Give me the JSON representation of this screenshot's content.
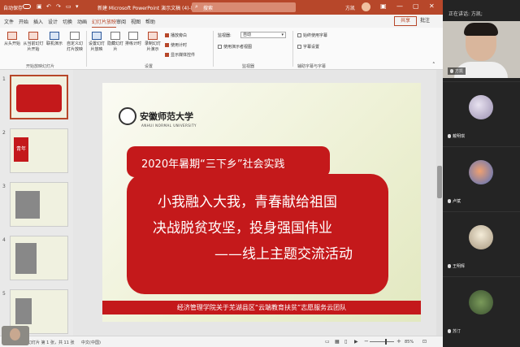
{
  "titlebar": {
    "autosave_label": "自动保存",
    "autosave_state": "关",
    "doc_title": "新建 Microsoft PowerPoint 演示文稿 (4)-已编辑.pptx",
    "search_placeholder": "搜索",
    "user_name": "方凯"
  },
  "menu": {
    "tabs": [
      "文件",
      "开始",
      "插入",
      "设计",
      "切换",
      "动画",
      "幻灯片放映",
      "审阅",
      "视图",
      "帮助"
    ],
    "active_index": 6,
    "share_label": "共享",
    "comment_label": "批注"
  },
  "ribbon": {
    "groups": [
      {
        "label": "开始放映幻灯片",
        "buttons": [
          "从头开始",
          "从当前幻灯片开始",
          "联机演示",
          "自定义幻灯片放映"
        ]
      },
      {
        "label": "设置",
        "buttons": [
          "设置幻灯片放映",
          "隐藏幻灯片",
          "排练计时",
          "录制幻灯片演示"
        ]
      },
      {
        "label": "监视器",
        "buttons": []
      },
      {
        "label": "辅助字幕与字幕",
        "buttons": []
      }
    ],
    "checkboxes": [
      {
        "label": "播放旁白",
        "checked": true
      },
      {
        "label": "使用计时",
        "checked": true
      },
      {
        "label": "显示媒体控件",
        "checked": true
      },
      {
        "label": "始终使用字幕",
        "checked": false
      }
    ],
    "monitor_label": "监视器:",
    "monitor_value": "自动",
    "presenter_view_label": "使用演示者视图",
    "subtitle_settings_label": "字幕设置"
  },
  "slide": {
    "university_name": "安徽师范大学",
    "university_en": "ANHUI NORMAL UNIVERSITY",
    "title": "2020年暑期“三下乡”社会实践",
    "line1": "小我融入大我，青春献给祖国",
    "line2": "决战脱贫攻坚，投身强国伟业",
    "line3": "——线上主题交流活动",
    "footer": "经济管理学院关于芜湖县区“云端教育扶贫”志愿服务云团队"
  },
  "thumbnails": {
    "numbers": [
      "1",
      "2",
      "3",
      "4",
      "5"
    ],
    "selected_index": 0,
    "slide2_text": "青年"
  },
  "statusbar": {
    "slide_info": "幻灯片 第 1 张，共 11 张",
    "language": "中文(中国)",
    "zoom": "85%"
  },
  "video_panel": {
    "title": "正在讲话: 方凯;",
    "participants": [
      "方凯",
      "戴明琪",
      "卢斌",
      "王明辉",
      "苏汀"
    ]
  },
  "colors": {
    "ppt_accent": "#b7472a",
    "slide_red": "#c4191b"
  }
}
